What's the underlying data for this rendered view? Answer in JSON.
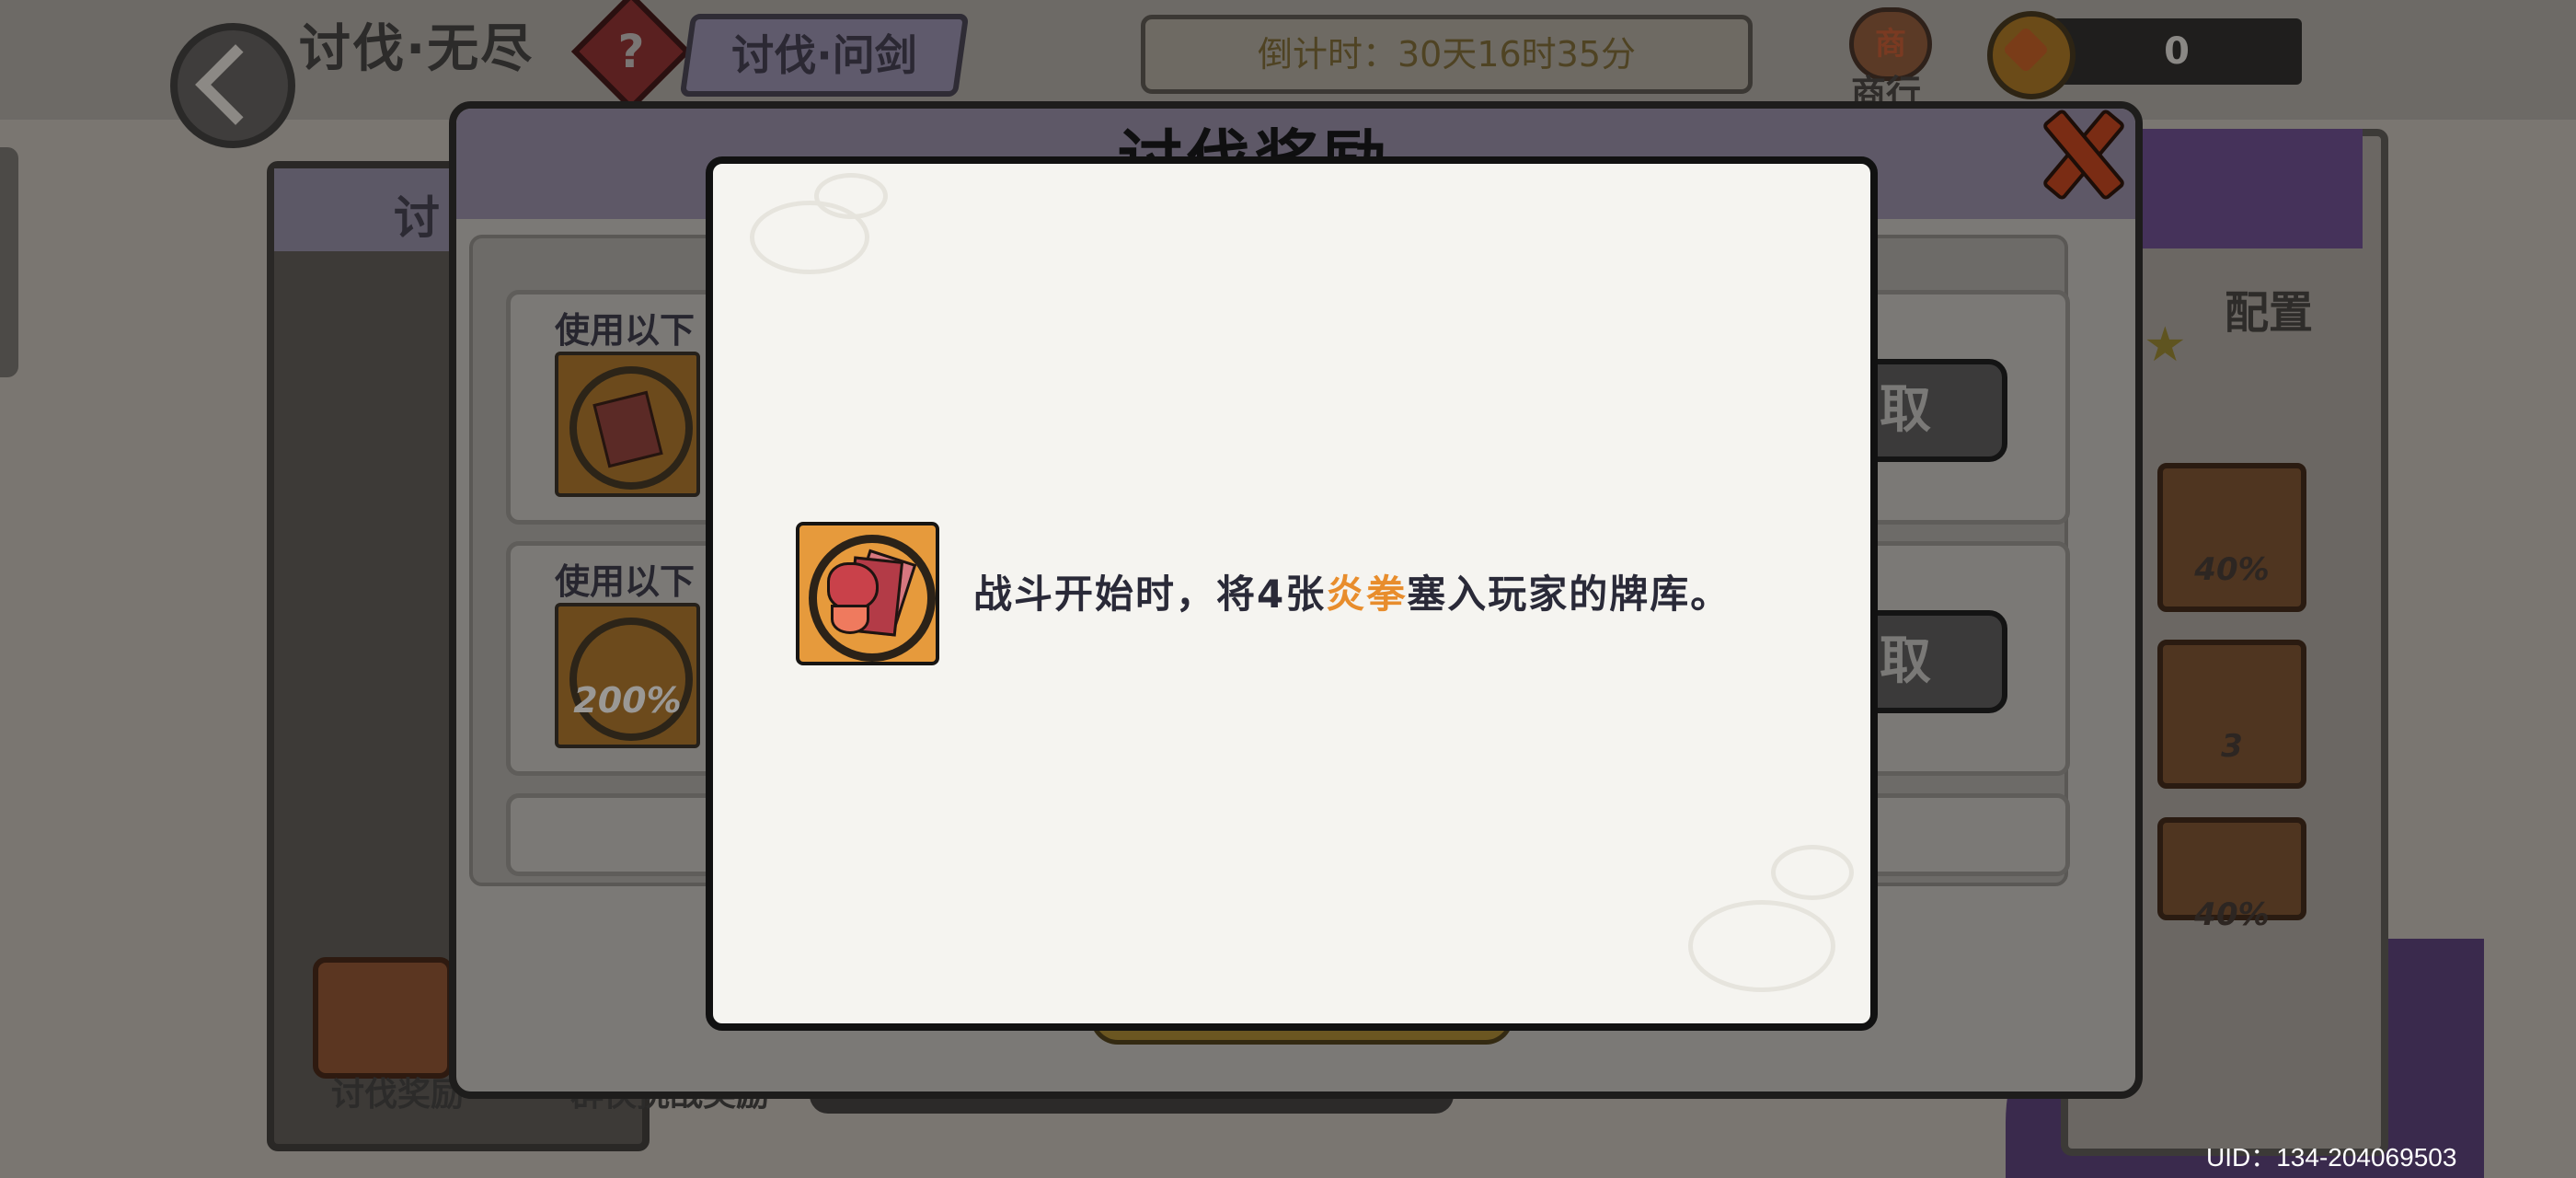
{
  "header": {
    "mode_title": "讨伐·无尽",
    "help_glyph": "?",
    "tab_label": "讨伐·问剑",
    "countdown": "倒计时：30天16时35分",
    "shop_glyph": "商",
    "shop_label": "商行",
    "currency_amount": "0"
  },
  "background": {
    "left_panel_tab": "讨",
    "bottom_tabs": [
      "讨伐奖励",
      "群侠挑战奖励"
    ],
    "config_label": "配置",
    "side_icons": [
      "40%",
      "3",
      "40%"
    ]
  },
  "reward_dialog": {
    "title": "讨伐奖励",
    "rows": [
      {
        "caption": "使用以下",
        "icon_label": "",
        "claim": "取"
      },
      {
        "caption": "使用以下",
        "icon_label": "200%",
        "claim": "取"
      }
    ]
  },
  "tooltip": {
    "text_before": "战斗开始时，将4张",
    "highlight": "炎拳",
    "text_after": "塞入玩家的牌库。",
    "highlight_color": "#e88d2c"
  },
  "footer": {
    "uid": "UID：134-204069503"
  }
}
